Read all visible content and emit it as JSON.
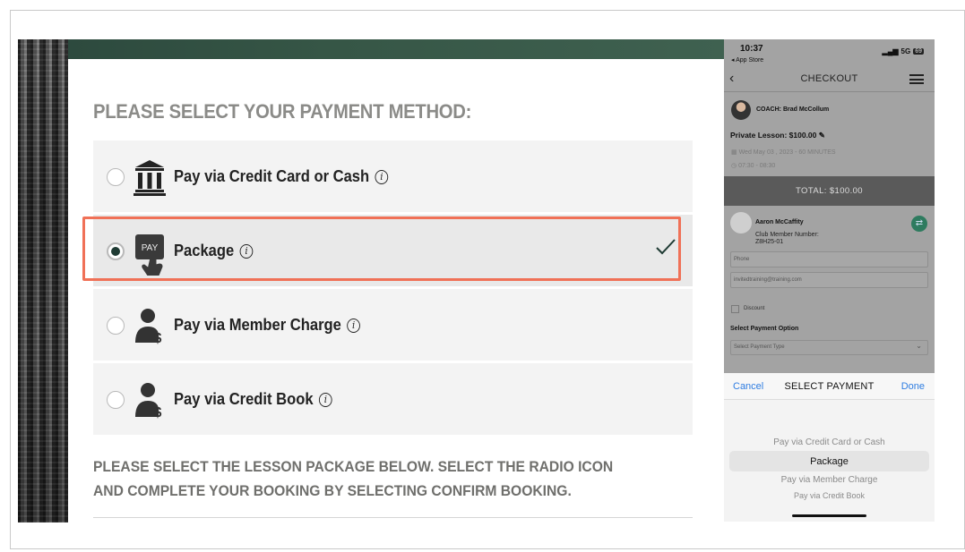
{
  "main": {
    "section_title": "PLEASE SELECT YOUR PAYMENT METHOD:",
    "options": [
      {
        "label": "Pay via Credit Card or Cash",
        "icon": "bank-icon",
        "selected": false
      },
      {
        "label": "Package",
        "icon": "pay-touch-icon",
        "icon_text": "PAY",
        "selected": true
      },
      {
        "label": "Pay via Member Charge",
        "icon": "user-dollar-icon",
        "selected": false
      },
      {
        "label": "Pay via Credit Book",
        "icon": "user-dollar-icon",
        "selected": false
      }
    ],
    "info_glyph": "i",
    "instructions": "PLEASE SELECT THE LESSON PACKAGE BELOW. SELECT THE RADIO ICON AND COMPLETE YOUR BOOKING BY SELECTING CONFIRM BOOKING."
  },
  "colors": {
    "highlight": "#f07157",
    "radio_fill": "#1f3b34",
    "banner": "#365646",
    "title_gray": "#8b8b88"
  },
  "phone": {
    "status": {
      "time": "10:37",
      "back_app": "◂ App Store",
      "network": "5G",
      "battery": "69"
    },
    "nav": {
      "title": "CHECKOUT"
    },
    "coach": "COACH: Brad McCollum",
    "lesson": "Private Lesson:  $100.00",
    "lesson_date": "Wed May 03 , 2023 - 60 MINUTES",
    "lesson_time": "07:30  -  08:30",
    "total": "TOTAL:  $100.00",
    "member": {
      "name": "Aaron McCaffity",
      "number_label": "Club Member Number:",
      "number": "Z8H25-01"
    },
    "fields": {
      "phone_placeholder": "Phone",
      "email": "invitedtraining@training.com"
    },
    "discount_label": "Discount",
    "payment_option_label": "Select Payment Option",
    "payment_type_placeholder": "Select Payment Type",
    "picker": {
      "cancel": "Cancel",
      "title": "SELECT PAYMENT",
      "done": "Done",
      "items": [
        "Pay via Credit Card or Cash",
        "Package",
        "Pay via Member Charge",
        "Pay via Credit Book"
      ],
      "current_index": 1
    }
  }
}
